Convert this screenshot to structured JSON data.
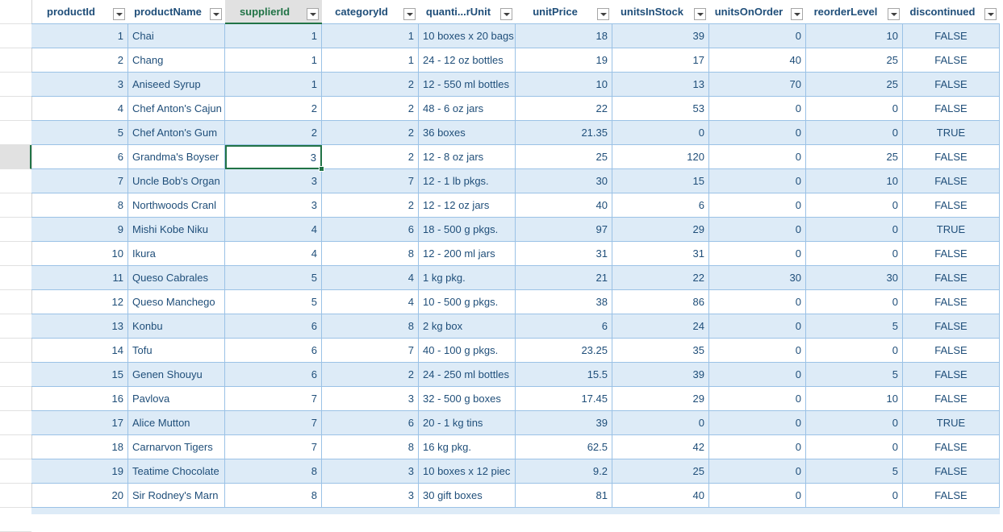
{
  "columns": [
    {
      "label": "productId"
    },
    {
      "label": "productName"
    },
    {
      "label": "supplierId"
    },
    {
      "label": "categoryId"
    },
    {
      "label": "quanti...rUnit"
    },
    {
      "label": "unitPrice"
    },
    {
      "label": "unitsInStock"
    },
    {
      "label": "unitsOnOrder"
    },
    {
      "label": "reorderLevel"
    },
    {
      "label": "discontinued"
    }
  ],
  "rows": [
    [
      "1",
      "Chai",
      "1",
      "1",
      "10 boxes x 20 bags",
      "18",
      "39",
      "0",
      "10",
      "FALSE"
    ],
    [
      "2",
      "Chang",
      "1",
      "1",
      "24 - 12 oz bottles",
      "19",
      "17",
      "40",
      "25",
      "FALSE"
    ],
    [
      "3",
      "Aniseed Syrup",
      "1",
      "2",
      "12 - 550 ml bottles",
      "10",
      "13",
      "70",
      "25",
      "FALSE"
    ],
    [
      "4",
      "Chef Anton's Cajun",
      "2",
      "2",
      "48 - 6 oz jars",
      "22",
      "53",
      "0",
      "0",
      "FALSE"
    ],
    [
      "5",
      "Chef Anton's Gum",
      "2",
      "2",
      "36 boxes",
      "21.35",
      "0",
      "0",
      "0",
      "TRUE"
    ],
    [
      "6",
      "Grandma's Boyser",
      "3",
      "2",
      "12 - 8 oz jars",
      "25",
      "120",
      "0",
      "25",
      "FALSE"
    ],
    [
      "7",
      "Uncle Bob's Organ",
      "3",
      "7",
      "12 - 1 lb pkgs.",
      "30",
      "15",
      "0",
      "10",
      "FALSE"
    ],
    [
      "8",
      "Northwoods Cranl",
      "3",
      "2",
      "12 - 12 oz jars",
      "40",
      "6",
      "0",
      "0",
      "FALSE"
    ],
    [
      "9",
      "Mishi Kobe Niku",
      "4",
      "6",
      "18 - 500 g pkgs.",
      "97",
      "29",
      "0",
      "0",
      "TRUE"
    ],
    [
      "10",
      "Ikura",
      "4",
      "8",
      "12 - 200 ml jars",
      "31",
      "31",
      "0",
      "0",
      "FALSE"
    ],
    [
      "11",
      "Queso Cabrales",
      "5",
      "4",
      "1 kg pkg.",
      "21",
      "22",
      "30",
      "30",
      "FALSE"
    ],
    [
      "12",
      "Queso Manchego",
      "5",
      "4",
      "10 - 500 g pkgs.",
      "38",
      "86",
      "0",
      "0",
      "FALSE"
    ],
    [
      "13",
      "Konbu",
      "6",
      "8",
      "2 kg box",
      "6",
      "24",
      "0",
      "5",
      "FALSE"
    ],
    [
      "14",
      "Tofu",
      "6",
      "7",
      "40 - 100 g pkgs.",
      "23.25",
      "35",
      "0",
      "0",
      "FALSE"
    ],
    [
      "15",
      "Genen Shouyu",
      "6",
      "2",
      "24 - 250 ml bottles",
      "15.5",
      "39",
      "0",
      "5",
      "FALSE"
    ],
    [
      "16",
      "Pavlova",
      "7",
      "3",
      "32 - 500 g boxes",
      "17.45",
      "29",
      "0",
      "10",
      "FALSE"
    ],
    [
      "17",
      "Alice Mutton",
      "7",
      "6",
      "20 - 1 kg tins",
      "39",
      "0",
      "0",
      "0",
      "TRUE"
    ],
    [
      "18",
      "Carnarvon Tigers",
      "7",
      "8",
      "16 kg pkg.",
      "62.5",
      "42",
      "0",
      "0",
      "FALSE"
    ],
    [
      "19",
      "Teatime Chocolate",
      "8",
      "3",
      "10 boxes x 12 piec",
      "9.2",
      "25",
      "0",
      "5",
      "FALSE"
    ],
    [
      "20",
      "Sir Rodney's Marn",
      "8",
      "3",
      "30 gift boxes",
      "81",
      "40",
      "0",
      "0",
      "FALSE"
    ]
  ],
  "selection": {
    "row": 5,
    "col": 2
  },
  "colors": {
    "band": "#ddebf7",
    "border": "#9bc2e6",
    "text": "#1f4e79",
    "selection": "#217346"
  }
}
